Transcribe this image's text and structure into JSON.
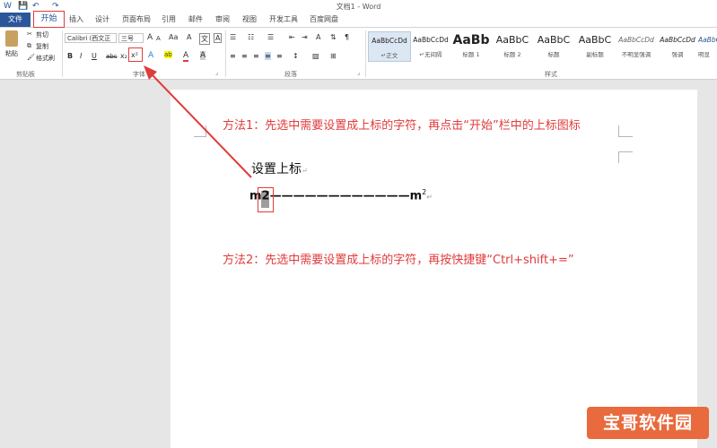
{
  "window": {
    "title": "文档1 - Word",
    "quick_access": [
      "W",
      "💾",
      "↶",
      "↷"
    ]
  },
  "tabs": {
    "file": "文件",
    "home": "开始",
    "items": [
      "插入",
      "设计",
      "页面布局",
      "引用",
      "邮件",
      "审阅",
      "视图",
      "开发工具",
      "百度网盘"
    ]
  },
  "clipboard": {
    "paste": "粘贴",
    "cut": "剪切",
    "copy": "复制",
    "format_painter": "格式刷",
    "group_label": "剪贴板"
  },
  "font": {
    "font_name": "Calibri (西文正",
    "font_size": "三号",
    "bold": "B",
    "italic": "I",
    "underline": "U",
    "strike": "abc",
    "subscript": "x₂",
    "superscript": "x²",
    "group_label": "字体",
    "grow": "A",
    "shrink": "A",
    "case": "Aa",
    "clear": "A",
    "effects": "A",
    "highlight": "ab",
    "color": "A",
    "char_border": "A",
    "wen": "文"
  },
  "paragraph": {
    "group_label": "段落"
  },
  "styles": {
    "group_label": "样式",
    "items": [
      {
        "sample": "AaBbCcDd",
        "name": "↵正文"
      },
      {
        "sample": "AaBbCcDd",
        "name": "↵无间隔"
      },
      {
        "sample": "AaBb",
        "name": "标题 1"
      },
      {
        "sample": "AaBbC",
        "name": "标题 2"
      },
      {
        "sample": "AaBbC",
        "name": "标题"
      },
      {
        "sample": "AaBbC",
        "name": "副标题"
      },
      {
        "sample": "AaBbCcDd",
        "name": "不明显强调"
      },
      {
        "sample": "AaBbCcDd",
        "name": "强调"
      },
      {
        "sample": "AaBbCcDd",
        "name": "明显"
      }
    ]
  },
  "document": {
    "note1": "方法1：先选中需要设置成上标的字符，再点击“开始”栏中的上标图标",
    "line1": "设置上标",
    "line2_prefix": "m",
    "line2_selected": "2",
    "line2_dashes": "————————————m",
    "line2_sup": "2",
    "note2": "方法2：先选中需要设置成上标的字符，再按快捷键“Ctrl+shift+=”",
    "para_mark": "↵"
  },
  "watermark": "宝哥软件园",
  "colors": {
    "annotation": "#e03b3b",
    "word_blue": "#2b579a"
  }
}
